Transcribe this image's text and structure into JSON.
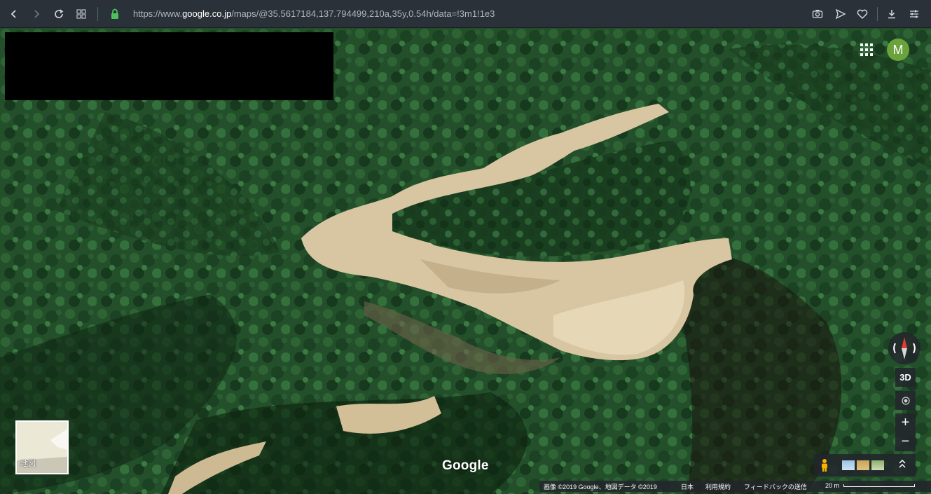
{
  "browser": {
    "url_prefix": "https://www.",
    "url_host": "google.co.jp",
    "url_path": "/maps/@35.5617184,137.794499,210a,35y,0.54h/data=!3m1!1e3",
    "icons": [
      "back-icon",
      "forward-icon",
      "reload-icon",
      "tabs-grid-icon",
      "lock-icon",
      "camera-icon",
      "send-icon",
      "heart-icon",
      "download-icon",
      "settings-sliders-icon"
    ]
  },
  "map": {
    "account_initial": "M",
    "account_color": "#6aa23c",
    "controls": {
      "three_d": "3D",
      "zoom_in": "+",
      "zoom_out": "−"
    },
    "minimap_label": "地図",
    "google_logo": "Google",
    "footer": {
      "imagery": "画像 ©2019 Google、地図データ ©2019",
      "country": "日本",
      "terms": "利用規約",
      "feedback": "フィードバックの送信",
      "scale": "20 m"
    },
    "colors": {
      "forest": "#1f4a26",
      "landslide": "#d8c6a2",
      "accent": "#e53935"
    }
  }
}
